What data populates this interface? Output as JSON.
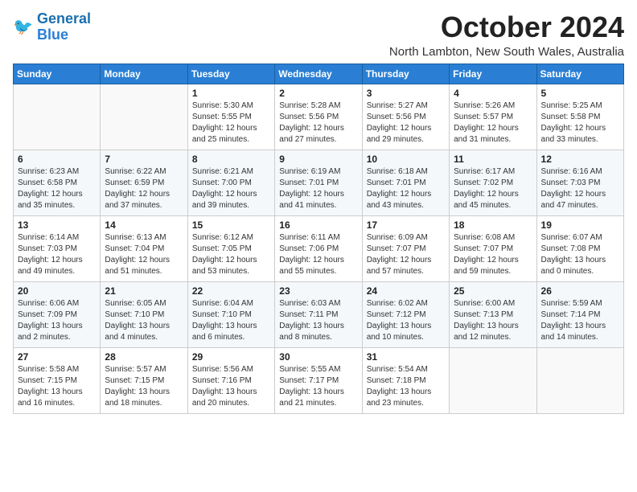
{
  "logo": {
    "line1": "General",
    "line2": "Blue"
  },
  "title": "October 2024",
  "subtitle": "North Lambton, New South Wales, Australia",
  "weekdays": [
    "Sunday",
    "Monday",
    "Tuesday",
    "Wednesday",
    "Thursday",
    "Friday",
    "Saturday"
  ],
  "weeks": [
    [
      {
        "day": "",
        "info": ""
      },
      {
        "day": "",
        "info": ""
      },
      {
        "day": "1",
        "info": "Sunrise: 5:30 AM\nSunset: 5:55 PM\nDaylight: 12 hours\nand 25 minutes."
      },
      {
        "day": "2",
        "info": "Sunrise: 5:28 AM\nSunset: 5:56 PM\nDaylight: 12 hours\nand 27 minutes."
      },
      {
        "day": "3",
        "info": "Sunrise: 5:27 AM\nSunset: 5:56 PM\nDaylight: 12 hours\nand 29 minutes."
      },
      {
        "day": "4",
        "info": "Sunrise: 5:26 AM\nSunset: 5:57 PM\nDaylight: 12 hours\nand 31 minutes."
      },
      {
        "day": "5",
        "info": "Sunrise: 5:25 AM\nSunset: 5:58 PM\nDaylight: 12 hours\nand 33 minutes."
      }
    ],
    [
      {
        "day": "6",
        "info": "Sunrise: 6:23 AM\nSunset: 6:58 PM\nDaylight: 12 hours\nand 35 minutes."
      },
      {
        "day": "7",
        "info": "Sunrise: 6:22 AM\nSunset: 6:59 PM\nDaylight: 12 hours\nand 37 minutes."
      },
      {
        "day": "8",
        "info": "Sunrise: 6:21 AM\nSunset: 7:00 PM\nDaylight: 12 hours\nand 39 minutes."
      },
      {
        "day": "9",
        "info": "Sunrise: 6:19 AM\nSunset: 7:01 PM\nDaylight: 12 hours\nand 41 minutes."
      },
      {
        "day": "10",
        "info": "Sunrise: 6:18 AM\nSunset: 7:01 PM\nDaylight: 12 hours\nand 43 minutes."
      },
      {
        "day": "11",
        "info": "Sunrise: 6:17 AM\nSunset: 7:02 PM\nDaylight: 12 hours\nand 45 minutes."
      },
      {
        "day": "12",
        "info": "Sunrise: 6:16 AM\nSunset: 7:03 PM\nDaylight: 12 hours\nand 47 minutes."
      }
    ],
    [
      {
        "day": "13",
        "info": "Sunrise: 6:14 AM\nSunset: 7:03 PM\nDaylight: 12 hours\nand 49 minutes."
      },
      {
        "day": "14",
        "info": "Sunrise: 6:13 AM\nSunset: 7:04 PM\nDaylight: 12 hours\nand 51 minutes."
      },
      {
        "day": "15",
        "info": "Sunrise: 6:12 AM\nSunset: 7:05 PM\nDaylight: 12 hours\nand 53 minutes."
      },
      {
        "day": "16",
        "info": "Sunrise: 6:11 AM\nSunset: 7:06 PM\nDaylight: 12 hours\nand 55 minutes."
      },
      {
        "day": "17",
        "info": "Sunrise: 6:09 AM\nSunset: 7:07 PM\nDaylight: 12 hours\nand 57 minutes."
      },
      {
        "day": "18",
        "info": "Sunrise: 6:08 AM\nSunset: 7:07 PM\nDaylight: 12 hours\nand 59 minutes."
      },
      {
        "day": "19",
        "info": "Sunrise: 6:07 AM\nSunset: 7:08 PM\nDaylight: 13 hours\nand 0 minutes."
      }
    ],
    [
      {
        "day": "20",
        "info": "Sunrise: 6:06 AM\nSunset: 7:09 PM\nDaylight: 13 hours\nand 2 minutes."
      },
      {
        "day": "21",
        "info": "Sunrise: 6:05 AM\nSunset: 7:10 PM\nDaylight: 13 hours\nand 4 minutes."
      },
      {
        "day": "22",
        "info": "Sunrise: 6:04 AM\nSunset: 7:10 PM\nDaylight: 13 hours\nand 6 minutes."
      },
      {
        "day": "23",
        "info": "Sunrise: 6:03 AM\nSunset: 7:11 PM\nDaylight: 13 hours\nand 8 minutes."
      },
      {
        "day": "24",
        "info": "Sunrise: 6:02 AM\nSunset: 7:12 PM\nDaylight: 13 hours\nand 10 minutes."
      },
      {
        "day": "25",
        "info": "Sunrise: 6:00 AM\nSunset: 7:13 PM\nDaylight: 13 hours\nand 12 minutes."
      },
      {
        "day": "26",
        "info": "Sunrise: 5:59 AM\nSunset: 7:14 PM\nDaylight: 13 hours\nand 14 minutes."
      }
    ],
    [
      {
        "day": "27",
        "info": "Sunrise: 5:58 AM\nSunset: 7:15 PM\nDaylight: 13 hours\nand 16 minutes."
      },
      {
        "day": "28",
        "info": "Sunrise: 5:57 AM\nSunset: 7:15 PM\nDaylight: 13 hours\nand 18 minutes."
      },
      {
        "day": "29",
        "info": "Sunrise: 5:56 AM\nSunset: 7:16 PM\nDaylight: 13 hours\nand 20 minutes."
      },
      {
        "day": "30",
        "info": "Sunrise: 5:55 AM\nSunset: 7:17 PM\nDaylight: 13 hours\nand 21 minutes."
      },
      {
        "day": "31",
        "info": "Sunrise: 5:54 AM\nSunset: 7:18 PM\nDaylight: 13 hours\nand 23 minutes."
      },
      {
        "day": "",
        "info": ""
      },
      {
        "day": "",
        "info": ""
      }
    ]
  ]
}
